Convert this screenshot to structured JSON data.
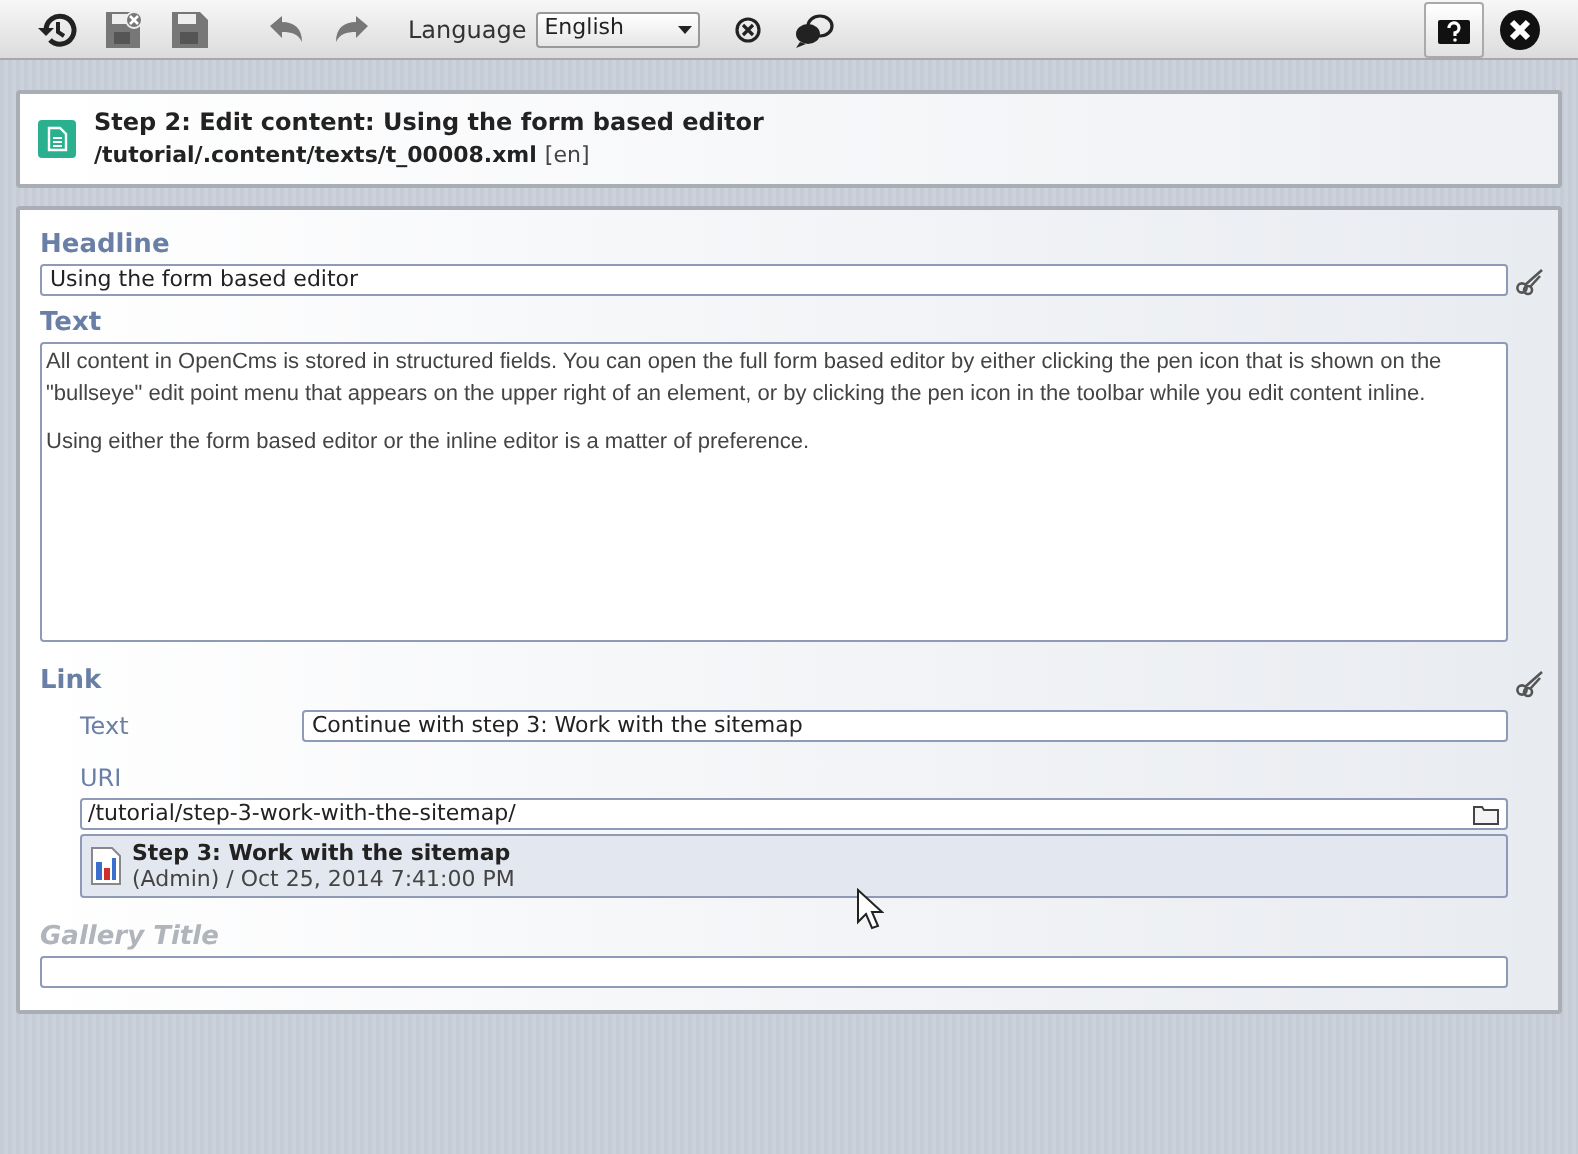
{
  "toolbar": {
    "language_label": "Language",
    "language": "English"
  },
  "header": {
    "title": "Step 2: Edit content: Using the form based editor",
    "path": "/tutorial/.content/texts/t_00008.xml",
    "locale": "[en]"
  },
  "fields": [
    {
      "kind": "text",
      "label": "Headline",
      "value": "Using the form based editor",
      "inactive": false
    },
    {
      "kind": "textarea",
      "label": "Text",
      "paragraphs": [
        "All content in OpenCms is stored in structured fields. You can open the full form based editor by either clicking the pen icon that is shown on the \"bullseye\" edit point menu that appears on the upper right of an element, or by clicking the pen icon in the toolbar while you edit content inline.",
        "Using either the form based editor or the inline editor is a matter of preference."
      ],
      "inactive": false
    },
    {
      "kind": "link",
      "label": "Link",
      "text_label": "Text",
      "text_value": "Continue with step 3: Work with the sitemap",
      "uri_label": "URI",
      "uri_value": "/tutorial/step-3-work-with-the-sitemap/",
      "resource_title": "Step 3: Work with the sitemap",
      "resource_info": "(Admin) / Oct 25, 2014 7:41:00 PM",
      "inactive": false
    },
    {
      "kind": "text",
      "label": "Gallery Title",
      "inactive": true
    }
  ]
}
